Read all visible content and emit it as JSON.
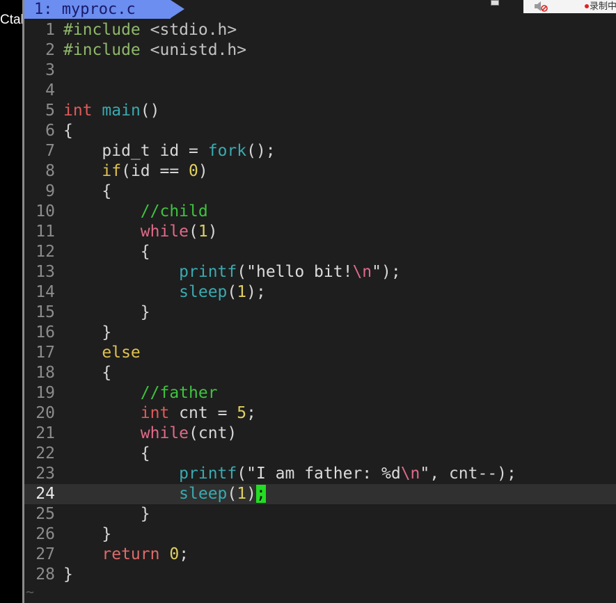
{
  "left_panel": {
    "label": "Ctalk"
  },
  "tabline": {
    "active_tab": "1: myproc.c"
  },
  "editor": {
    "cursor_line": "24",
    "lines": [
      {
        "num": "1",
        "tokens": [
          {
            "t": "#include ",
            "c": "pre"
          },
          {
            "t": "<stdio.h>",
            "c": "inc"
          }
        ]
      },
      {
        "num": "2",
        "tokens": [
          {
            "t": "#include ",
            "c": "pre"
          },
          {
            "t": "<unistd.h>",
            "c": "inc"
          }
        ]
      },
      {
        "num": "3",
        "tokens": []
      },
      {
        "num": "4",
        "tokens": []
      },
      {
        "num": "5",
        "tokens": [
          {
            "t": "int",
            "c": "type"
          },
          {
            "t": " ",
            "c": "punct"
          },
          {
            "t": "main",
            "c": "fn"
          },
          {
            "t": "()",
            "c": "punct"
          }
        ]
      },
      {
        "num": "6",
        "tokens": [
          {
            "t": "{",
            "c": "punct"
          }
        ]
      },
      {
        "num": "7",
        "tokens": [
          {
            "t": "    pid_t id = ",
            "c": "punct"
          },
          {
            "t": "fork",
            "c": "fn"
          },
          {
            "t": "();",
            "c": "punct"
          }
        ]
      },
      {
        "num": "8",
        "tokens": [
          {
            "t": "    ",
            "c": "punct"
          },
          {
            "t": "if",
            "c": "kw"
          },
          {
            "t": "(id == ",
            "c": "punct"
          },
          {
            "t": "0",
            "c": "num"
          },
          {
            "t": ")",
            "c": "punct"
          }
        ]
      },
      {
        "num": "9",
        "tokens": [
          {
            "t": "    {",
            "c": "punct"
          }
        ]
      },
      {
        "num": "10",
        "tokens": [
          {
            "t": "        ",
            "c": "punct"
          },
          {
            "t": "//child",
            "c": "com"
          }
        ]
      },
      {
        "num": "11",
        "tokens": [
          {
            "t": "        ",
            "c": "punct"
          },
          {
            "t": "while",
            "c": "ctrl"
          },
          {
            "t": "(",
            "c": "punct"
          },
          {
            "t": "1",
            "c": "num"
          },
          {
            "t": ")",
            "c": "punct"
          }
        ]
      },
      {
        "num": "12",
        "tokens": [
          {
            "t": "        {",
            "c": "punct"
          }
        ]
      },
      {
        "num": "13",
        "tokens": [
          {
            "t": "            ",
            "c": "punct"
          },
          {
            "t": "printf",
            "c": "fn"
          },
          {
            "t": "(",
            "c": "punct"
          },
          {
            "t": "\"hello bit!",
            "c": "str"
          },
          {
            "t": "\\n",
            "c": "esc"
          },
          {
            "t": "\"",
            "c": "str"
          },
          {
            "t": ");",
            "c": "punct"
          }
        ]
      },
      {
        "num": "14",
        "tokens": [
          {
            "t": "            ",
            "c": "punct"
          },
          {
            "t": "sleep",
            "c": "fn"
          },
          {
            "t": "(",
            "c": "punct"
          },
          {
            "t": "1",
            "c": "num"
          },
          {
            "t": ");",
            "c": "punct"
          }
        ]
      },
      {
        "num": "15",
        "tokens": [
          {
            "t": "        }",
            "c": "punct"
          }
        ]
      },
      {
        "num": "16",
        "tokens": [
          {
            "t": "    }",
            "c": "punct"
          }
        ]
      },
      {
        "num": "17",
        "tokens": [
          {
            "t": "    ",
            "c": "punct"
          },
          {
            "t": "else",
            "c": "kw"
          }
        ]
      },
      {
        "num": "18",
        "tokens": [
          {
            "t": "    {",
            "c": "punct"
          }
        ]
      },
      {
        "num": "19",
        "tokens": [
          {
            "t": "        ",
            "c": "punct"
          },
          {
            "t": "//father",
            "c": "com"
          }
        ]
      },
      {
        "num": "20",
        "tokens": [
          {
            "t": "        ",
            "c": "punct"
          },
          {
            "t": "int",
            "c": "type"
          },
          {
            "t": " cnt = ",
            "c": "punct"
          },
          {
            "t": "5",
            "c": "num"
          },
          {
            "t": ";",
            "c": "punct"
          }
        ]
      },
      {
        "num": "21",
        "tokens": [
          {
            "t": "        ",
            "c": "punct"
          },
          {
            "t": "while",
            "c": "ctrl"
          },
          {
            "t": "(cnt)",
            "c": "punct"
          }
        ]
      },
      {
        "num": "22",
        "tokens": [
          {
            "t": "        {",
            "c": "punct"
          }
        ]
      },
      {
        "num": "23",
        "tokens": [
          {
            "t": "            ",
            "c": "punct"
          },
          {
            "t": "printf",
            "c": "fn"
          },
          {
            "t": "(",
            "c": "punct"
          },
          {
            "t": "\"I am father: %d",
            "c": "str"
          },
          {
            "t": "\\n",
            "c": "esc"
          },
          {
            "t": "\"",
            "c": "str"
          },
          {
            "t": ", cnt--);",
            "c": "punct"
          }
        ]
      },
      {
        "num": "24",
        "tokens": [
          {
            "t": "            ",
            "c": "punct"
          },
          {
            "t": "sleep",
            "c": "fn"
          },
          {
            "t": "(",
            "c": "punct"
          },
          {
            "t": "1",
            "c": "num"
          },
          {
            "t": ")",
            "c": "punct"
          },
          {
            "t": ";",
            "c": "cursor"
          }
        ]
      },
      {
        "num": "25",
        "tokens": [
          {
            "t": "        }",
            "c": "punct"
          }
        ]
      },
      {
        "num": "26",
        "tokens": [
          {
            "t": "    }",
            "c": "punct"
          }
        ]
      },
      {
        "num": "27",
        "tokens": [
          {
            "t": "    ",
            "c": "punct"
          },
          {
            "t": "return",
            "c": "ret"
          },
          {
            "t": " ",
            "c": "punct"
          },
          {
            "t": "0",
            "c": "num"
          },
          {
            "t": ";",
            "c": "punct"
          }
        ]
      },
      {
        "num": "28",
        "tokens": [
          {
            "t": "}",
            "c": "punct"
          }
        ]
      }
    ],
    "empty_line_marker": "~"
  },
  "recorder": {
    "status_label": "录制中",
    "speaker_icon": "speaker-muted-icon",
    "record_color": "#e02020"
  },
  "colors": {
    "tab_active": "#6b8ef0",
    "cursor": "#22dd22",
    "background": "#1e1e1e"
  }
}
